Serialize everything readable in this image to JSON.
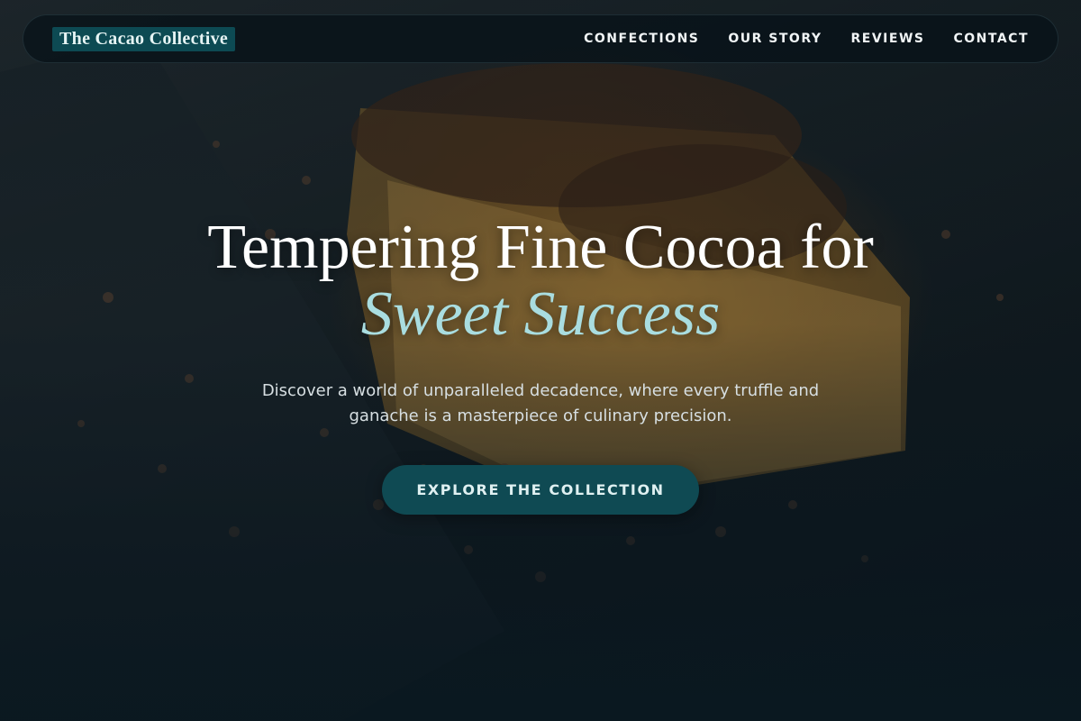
{
  "brand": {
    "name": "The Cacao Collective",
    "accent_color": "#0d4a53"
  },
  "nav": {
    "items": [
      {
        "label": "CONFECTIONS"
      },
      {
        "label": "OUR STORY"
      },
      {
        "label": "REVIEWS"
      },
      {
        "label": "CONTACT"
      }
    ]
  },
  "hero": {
    "title_line1": "Tempering Fine Cocoa for",
    "title_line2": "Sweet Success",
    "subtitle": "Discover a world of unparalleled decadence, where every truffle and ganache is a masterpiece of culinary precision.",
    "cta_label": "EXPLORE THE COLLECTION",
    "accent_text_color": "#a9dde0",
    "background_image": "cheesecake-slice-with-chocolate-shavings"
  }
}
